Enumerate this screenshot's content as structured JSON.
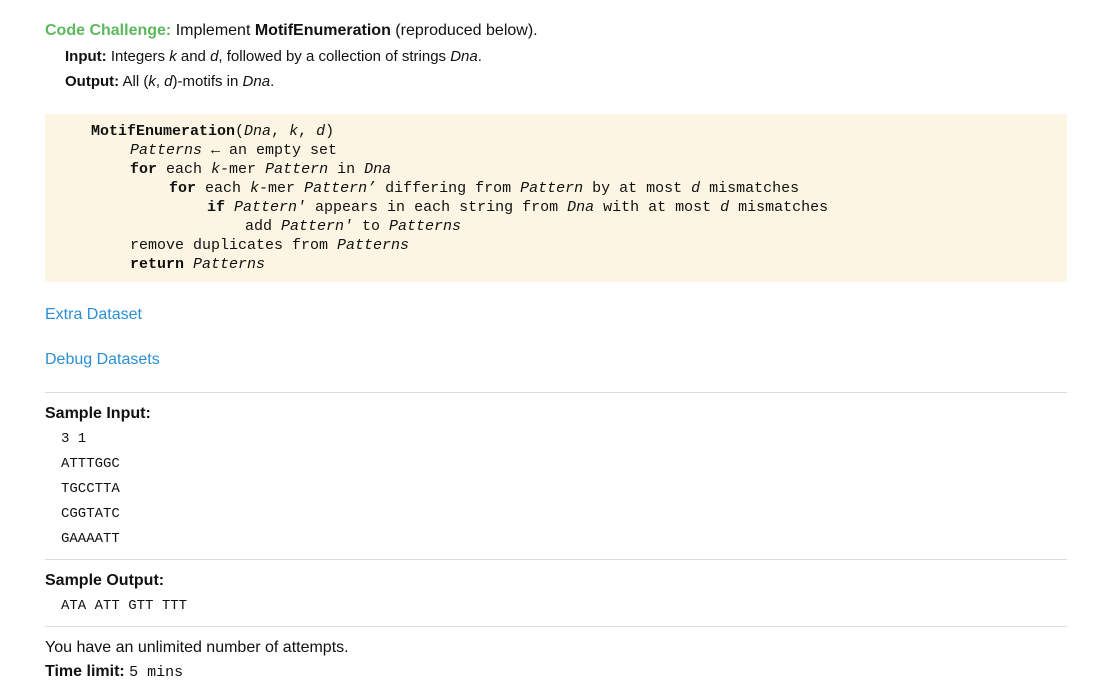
{
  "challenge": {
    "label": "Code Challenge:",
    "prefix": "Implement",
    "name": "MotifEnumeration",
    "suffix": "(reproduced below).",
    "input_label": "Input:",
    "input_text_1": "Integers",
    "input_k": "k",
    "input_and": "and",
    "input_d": "d",
    "input_text_2": ", followed by a collection of strings",
    "input_dna": "Dna",
    "input_end": ".",
    "output_label": "Output:",
    "output_text_1": "All (",
    "output_k": "k",
    "output_comma": ",",
    "output_d": "d",
    "output_text_2": ")-motifs in",
    "output_dna": "Dna",
    "output_end": "."
  },
  "pseudocode": {
    "l1_fn": "MotifEnumeration",
    "l1_args_open": "(",
    "l1_dna": "Dna",
    "l1_c1": ", ",
    "l1_k": "k",
    "l1_c2": ", ",
    "l1_d": "d",
    "l1_close": ")",
    "l2_patterns": "Patterns",
    "l2_rest": " ← an empty set",
    "l3_for": "for",
    "l3_each": " each ",
    "l3_k": "k",
    "l3_mer": "-mer ",
    "l3_pattern": "Pattern",
    "l3_in": " in ",
    "l3_dna": "Dna",
    "l4_for": "for",
    "l4_each": " each ",
    "l4_k": "k",
    "l4_mer": "-mer ",
    "l4_patternp": "Pattern’",
    "l4_diff": " differing from ",
    "l4_pattern": "Pattern",
    "l4_by": " by at most ",
    "l4_d": "d",
    "l4_mm": " mismatches",
    "l5_if": "if",
    "l5_sp": " ",
    "l5_patternp": "Pattern'",
    "l5_appears": " appears in each string from ",
    "l5_dna": "Dna",
    "l5_with": " with at most ",
    "l5_d": "d",
    "l5_mm": " mismatches",
    "l6_add": "add ",
    "l6_patternp": "Pattern'",
    "l6_to": " to ",
    "l6_patterns": "Patterns",
    "l7_remove": "remove duplicates from ",
    "l7_patterns": "Patterns",
    "l8_return": "return",
    "l8_sp": " ",
    "l8_patterns": "Patterns"
  },
  "links": {
    "extra_dataset": "Extra Dataset",
    "debug_datasets": "Debug Datasets"
  },
  "sample_input": {
    "label": "Sample Input:",
    "lines": [
      "3 1",
      "ATTTGGC",
      "TGCCTTA",
      "CGGTATC",
      "GAAAATT"
    ]
  },
  "sample_output": {
    "label": "Sample Output:",
    "value": "ATA ATT GTT TTT"
  },
  "footer": {
    "attempts": "You have an unlimited number of attempts.",
    "time_label": "Time limit:",
    "time_value": "5 mins"
  }
}
